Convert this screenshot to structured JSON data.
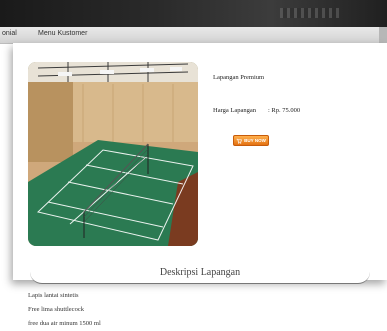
{
  "navbar": {
    "left_item": "onial",
    "customer_menu": "Menu Kustomer"
  },
  "product": {
    "name": "Lapangan Premium",
    "price_label": "Harga Lapangan",
    "price_value": ": Rp. 75.000",
    "buy_label": "BUY NOW",
    "image_icon": "badminton-court-photo"
  },
  "description": {
    "title": "Deskripsi Lapangan",
    "features": [
      "Lapis lantai sintetis",
      "Free lima shuttlecock",
      "free dua air minum 1500 ml"
    ]
  },
  "colors": {
    "buy_button": "#e37112",
    "court_green": "#2b7a52",
    "wall": "#d4b48a"
  }
}
